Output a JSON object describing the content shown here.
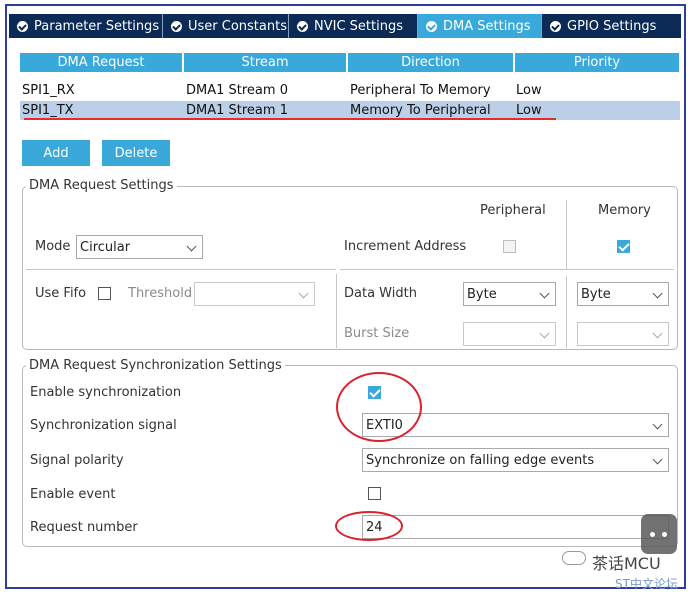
{
  "tabs": [
    {
      "label": "Parameter Settings",
      "active": false
    },
    {
      "label": "User Constants",
      "active": false
    },
    {
      "label": "NVIC Settings",
      "active": false
    },
    {
      "label": "DMA Settings",
      "active": true
    },
    {
      "label": "GPIO Settings",
      "active": false
    }
  ],
  "dma_table": {
    "headers": [
      "DMA Request",
      "Stream",
      "Direction",
      "Priority"
    ],
    "rows": [
      {
        "request": "SPI1_RX",
        "stream": "DMA1 Stream 0",
        "direction": "Peripheral To Memory",
        "priority": "Low",
        "selected": false
      },
      {
        "request": "SPI1_TX",
        "stream": "DMA1 Stream 1",
        "direction": "Memory To Peripheral",
        "priority": "Low",
        "selected": true
      }
    ]
  },
  "buttons": {
    "add": "Add",
    "delete": "Delete"
  },
  "request_settings": {
    "title": "DMA Request Settings",
    "peripheral_header": "Peripheral",
    "memory_header": "Memory",
    "mode_label": "Mode",
    "mode_value": "Circular",
    "increment_label": "Increment Address",
    "peripheral_increment": false,
    "memory_increment": true,
    "use_fifo_label": "Use Fifo",
    "use_fifo": false,
    "threshold_label": "Threshold",
    "threshold_value": "",
    "data_width_label": "Data Width",
    "peripheral_data_width": "Byte",
    "memory_data_width": "Byte",
    "burst_size_label": "Burst Size",
    "peripheral_burst": "",
    "memory_burst": ""
  },
  "sync_settings": {
    "title": "DMA Request Synchronization Settings",
    "enable_sync_label": "Enable synchronization",
    "enable_sync": true,
    "signal_label": "Synchronization signal",
    "signal_value": "EXTI0",
    "polarity_label": "Signal polarity",
    "polarity_value": "Synchronize on falling edge events",
    "enable_event_label": "Enable event",
    "enable_event": false,
    "request_number_label": "Request number",
    "request_number_value": "24"
  },
  "watermark": {
    "brand": "茶话MCU",
    "forum": "ST中文论坛"
  },
  "colors": {
    "accent": "#39a9db",
    "tab_bar": "#0b2a55",
    "selected_row": "#bccfe8",
    "annotation_red": "#d9232e",
    "frame_border": "#2e3f9b"
  }
}
